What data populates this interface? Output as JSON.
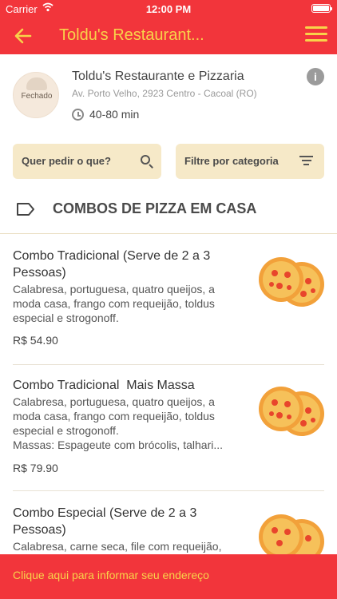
{
  "status_bar": {
    "carrier": "Carrier",
    "time": "12:00 PM"
  },
  "nav": {
    "title": "Toldu's Restaurant..."
  },
  "restaurant": {
    "name": "Toldu's Restaurante e Pizzaria",
    "address": "Av. Porto Velho, 2923 Centro - Cacoal  (RO)",
    "status": "Fechado",
    "delivery_time": "40-80 min"
  },
  "filters": {
    "search_placeholder": "Quer pedir o que?",
    "category_label": "Filtre por categoria"
  },
  "section": {
    "title": "COMBOS DE PIZZA EM CASA"
  },
  "products": [
    {
      "name": "Combo Tradicional (Serve de 2 a 3 Pessoas)",
      "description": "Calabresa, portuguesa, quatro queijos, a moda casa, frango com requeijão, toldus especial e strogonoff.",
      "price": "R$ 54.90"
    },
    {
      "name": "Combo Tradicional  Mais Massa",
      "description_lines": [
        "Calabresa, portuguesa, quatro queijos, a moda casa, frango com requeijão, toldus especial e strogonoff.",
        "Massas: Espageute com brócolis, talhari..."
      ],
      "price": "R$ 79.90"
    },
    {
      "name": "Combo Especial (Serve de 2 a 3 Pessoas)",
      "description": "Calabresa, carne seca, file com requeijão,"
    }
  ],
  "bottom_bar": {
    "text": "Clique aqui para informar seu endereço"
  },
  "colors": {
    "brand_red": "#f2353b",
    "accent_yellow": "#f8d34a",
    "filter_bg": "#f6e9c8"
  }
}
